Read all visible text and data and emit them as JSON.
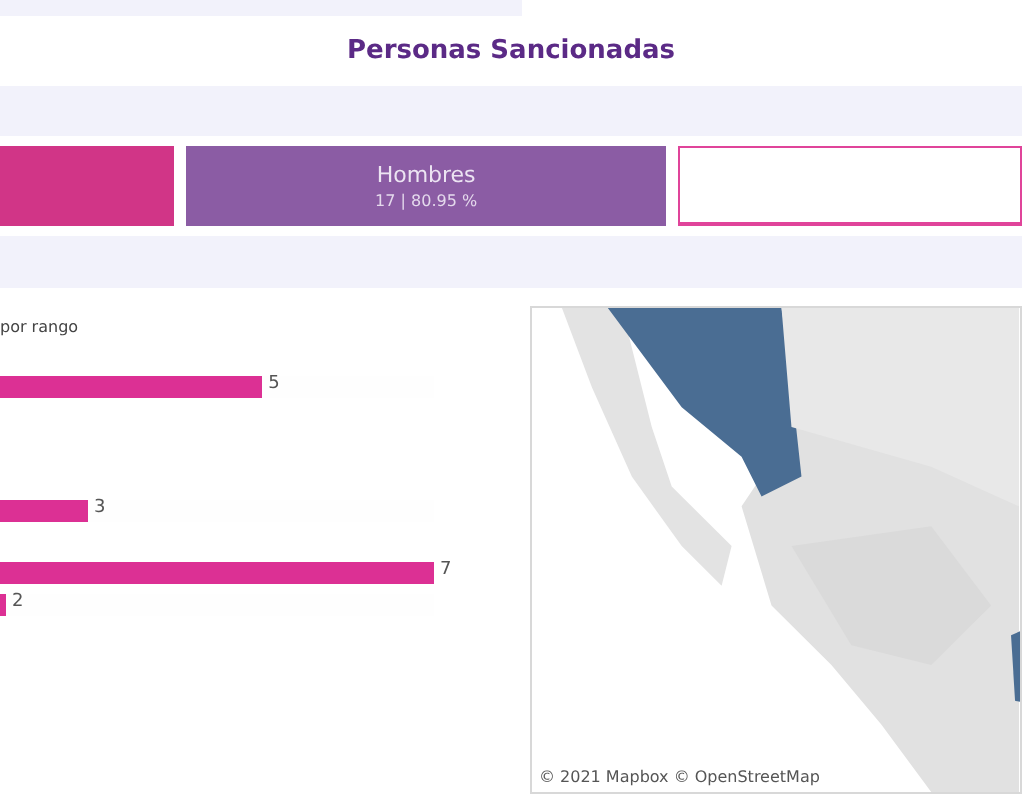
{
  "title": "Personas Sancionadas",
  "cards": [
    {
      "kind": "filled",
      "color": "#d13587"
    },
    {
      "kind": "filled",
      "color": "#8b5ca4",
      "label": "Hombres",
      "value": "17 | 80.95 %"
    },
    {
      "kind": "outline",
      "color": "#e0449a"
    }
  ],
  "bar_chart": {
    "title": "por rango",
    "bars": [
      {
        "level": 0.604,
        "value": "5"
      },
      {
        "level": 0.203,
        "value": "3"
      },
      {
        "level": 1,
        "value": "7"
      },
      {
        "level": 0.014,
        "value": "2"
      }
    ]
  },
  "map": {
    "attribution": "© 2021 Mapbox © OpenStreetMap"
  }
}
